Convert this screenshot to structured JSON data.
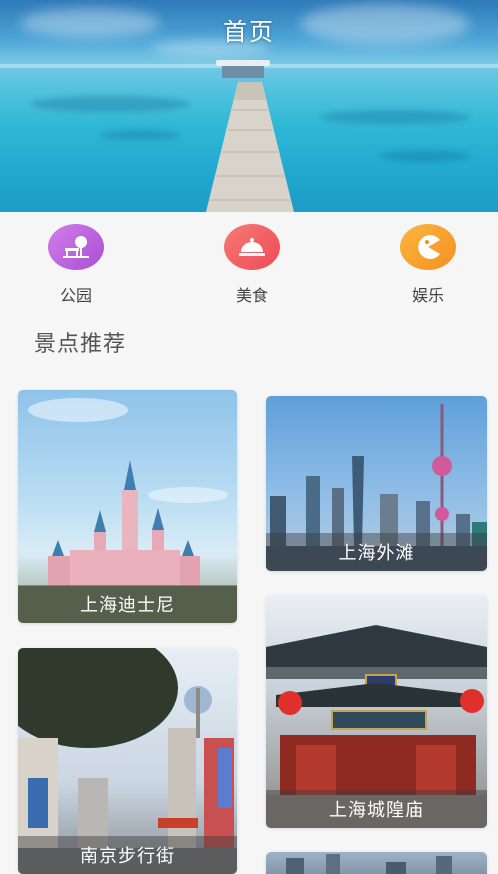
{
  "header": {
    "title": "首页"
  },
  "categories": [
    {
      "label": "公园",
      "icon": "park-icon",
      "color": "#c06ae0"
    },
    {
      "label": "美食",
      "icon": "food-cloche-icon",
      "color": "#f25c62"
    },
    {
      "label": "娱乐",
      "icon": "entertainment-pacman-icon",
      "color": "#f8a22c"
    }
  ],
  "section": {
    "title": "景点推荐"
  },
  "spots": [
    {
      "name": "上海迪士尼"
    },
    {
      "name": "上海外滩"
    },
    {
      "name": "南京步行街"
    },
    {
      "name": "上海城隍庙"
    },
    {
      "name": ""
    }
  ]
}
